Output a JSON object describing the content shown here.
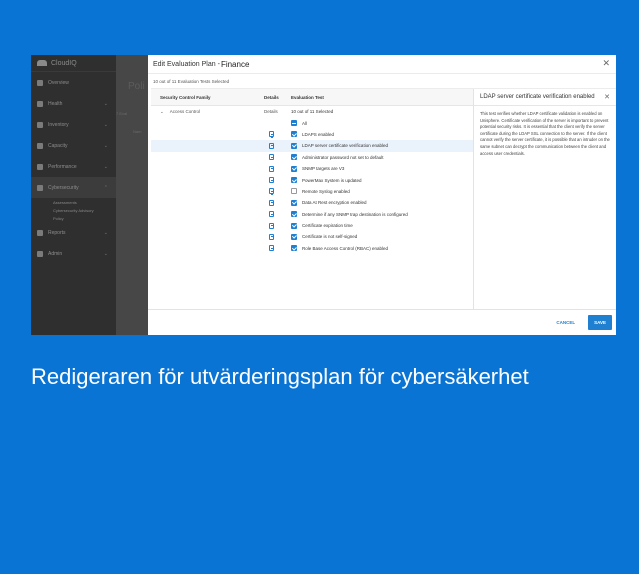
{
  "background_app": {
    "logo": "CloudIQ",
    "nav": [
      {
        "label": "Overview"
      },
      {
        "label": "Health"
      },
      {
        "label": "Inventory"
      },
      {
        "label": "Capacity"
      },
      {
        "label": "Performance"
      },
      {
        "label": "Cybersecurity"
      }
    ],
    "subnav": [
      "Assessments",
      "Cybersecurity Advisory",
      "Policy"
    ],
    "nav2": [
      {
        "label": "Reports"
      },
      {
        "label": "Admin"
      }
    ],
    "title": "Poli",
    "text1": "7 Eval",
    "text2": "Nam"
  },
  "modal": {
    "title_prefix": "Edit Evaluation Plan - ",
    "title_name": "Finance",
    "selected_count": "10 out of 11 Evaluation Tests Selected",
    "columns": {
      "family": "Security Control Family",
      "details": "Details",
      "test": "Evaluation Test"
    },
    "family": "Access Control",
    "test_selected": "10 out of 11 Selected",
    "tests": [
      {
        "label": "All",
        "state": "mixed",
        "details": false
      },
      {
        "label": "LDAPS enabled",
        "state": "on",
        "details": true
      },
      {
        "label": "LDAP server certificate verification enabled",
        "state": "on",
        "details": true,
        "highlight": true
      },
      {
        "label": "Administrator password not set to default",
        "state": "on",
        "details": true
      },
      {
        "label": "SNMP targets are V3",
        "state": "on",
        "details": true
      },
      {
        "label": "PowerMax System is updated",
        "state": "on",
        "details": true
      },
      {
        "label": "Remote Syslog enabled",
        "state": "off",
        "details": true
      },
      {
        "label": "Data At Rest encryption enabled",
        "state": "on",
        "details": true
      },
      {
        "label": "Determine if any SNMP trap destination is configured",
        "state": "on",
        "details": true
      },
      {
        "label": "Certificate expiration time",
        "state": "on",
        "details": true
      },
      {
        "label": "Certificate is not self-signed",
        "state": "on",
        "details": true
      },
      {
        "label": "Role Base Access Control (RBAC) enabled",
        "state": "on",
        "details": true
      }
    ],
    "panel": {
      "title": "LDAP server certificate verification enabled",
      "text": "This test verifies whether LDAP certificate validation is enabled on Unisphere. Certificate verification of the server is important to prevent potential security risks. It is essential that the client verify the server certificate during the LDAP SSL connection to the server. If the client cannot verify the server certificate, it is possible that an intruder on the same subnet can decrypt the communication between the client and access user credentials."
    },
    "cancel": "CANCEL",
    "save": "SAVE"
  },
  "caption": "Redigeraren för utvärderingsplan för cybersäkerhet",
  "colors": {
    "background": "#0a74d4",
    "accent": "#1f7fd0"
  }
}
